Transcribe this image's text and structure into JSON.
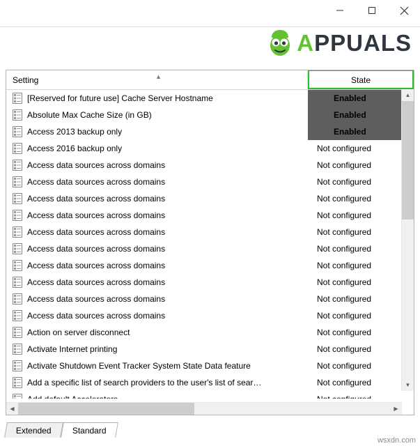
{
  "window": {
    "buttons": [
      {
        "name": "minimize",
        "label": "Minimize"
      },
      {
        "name": "maximize",
        "label": "Maximize"
      },
      {
        "name": "close",
        "label": "Close"
      }
    ]
  },
  "branding": {
    "logo_text_a": "A",
    "logo_text_rest": "PPUALS",
    "accent_color": "#63c132",
    "footer": "wsxdn.com"
  },
  "listview": {
    "columns": [
      {
        "key": "setting",
        "label": "Setting"
      },
      {
        "key": "state",
        "label": "State"
      }
    ],
    "sort_indicator": "▲",
    "highlight_color": "#2bbf2b",
    "rows": [
      {
        "setting": "[Reserved for future use] Cache Server Hostname",
        "state": "Enabled",
        "state_style": "dark"
      },
      {
        "setting": "Absolute Max Cache Size (in GB)",
        "state": "Enabled",
        "state_style": "dark"
      },
      {
        "setting": "Access 2013 backup only",
        "state": "Enabled",
        "state_style": "dark"
      },
      {
        "setting": "Access 2016 backup only",
        "state": "Not configured",
        "state_style": "normal"
      },
      {
        "setting": "Access data sources across domains",
        "state": "Not configured",
        "state_style": "normal"
      },
      {
        "setting": "Access data sources across domains",
        "state": "Not configured",
        "state_style": "normal"
      },
      {
        "setting": "Access data sources across domains",
        "state": "Not configured",
        "state_style": "normal"
      },
      {
        "setting": "Access data sources across domains",
        "state": "Not configured",
        "state_style": "normal"
      },
      {
        "setting": "Access data sources across domains",
        "state": "Not configured",
        "state_style": "normal"
      },
      {
        "setting": "Access data sources across domains",
        "state": "Not configured",
        "state_style": "normal"
      },
      {
        "setting": "Access data sources across domains",
        "state": "Not configured",
        "state_style": "normal"
      },
      {
        "setting": "Access data sources across domains",
        "state": "Not configured",
        "state_style": "normal"
      },
      {
        "setting": "Access data sources across domains",
        "state": "Not configured",
        "state_style": "normal"
      },
      {
        "setting": "Access data sources across domains",
        "state": "Not configured",
        "state_style": "normal"
      },
      {
        "setting": "Action on server disconnect",
        "state": "Not configured",
        "state_style": "normal"
      },
      {
        "setting": "Activate Internet printing",
        "state": "Not configured",
        "state_style": "normal"
      },
      {
        "setting": "Activate Shutdown Event Tracker System State Data feature",
        "state": "Not configured",
        "state_style": "normal"
      },
      {
        "setting": "Add a specific list of search providers to the user's list of sear…",
        "state": "Not configured",
        "state_style": "normal"
      },
      {
        "setting": "Add default Accelerators",
        "state": "Not configured",
        "state_style": "normal"
      }
    ]
  },
  "tabs": [
    {
      "label": "Extended",
      "active": false
    },
    {
      "label": "Standard",
      "active": true
    }
  ]
}
